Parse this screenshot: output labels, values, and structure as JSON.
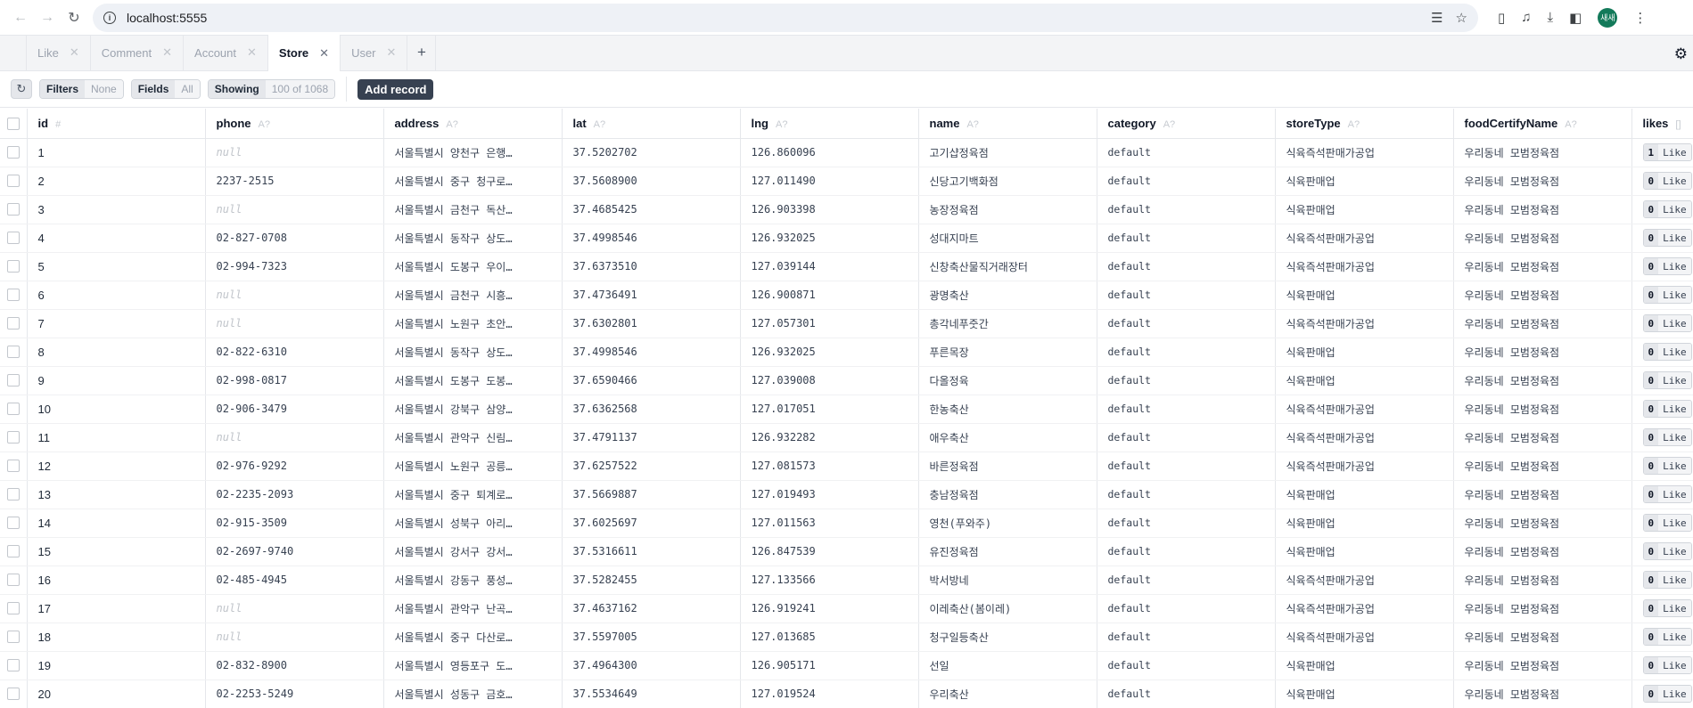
{
  "browser": {
    "url": "localhost:5555",
    "avatar_text": "새새"
  },
  "tabs": [
    {
      "label": "Like",
      "active": false
    },
    {
      "label": "Comment",
      "active": false
    },
    {
      "label": "Account",
      "active": false
    },
    {
      "label": "Store",
      "active": true
    },
    {
      "label": "User",
      "active": false
    }
  ],
  "toolbar": {
    "filters_label": "Filters",
    "filters_value": "None",
    "fields_label": "Fields",
    "fields_value": "All",
    "showing_label": "Showing",
    "showing_value": "100 of 1068",
    "add_record_label": "Add record"
  },
  "columns": [
    {
      "name": "id",
      "type": "#"
    },
    {
      "name": "phone",
      "type": "A?"
    },
    {
      "name": "address",
      "type": "A?"
    },
    {
      "name": "lat",
      "type": "A?"
    },
    {
      "name": "lng",
      "type": "A?"
    },
    {
      "name": "name",
      "type": "A?"
    },
    {
      "name": "category",
      "type": "A?"
    },
    {
      "name": "storeType",
      "type": "A?"
    },
    {
      "name": "foodCertifyName",
      "type": "A?"
    },
    {
      "name": "likes",
      "type": "[]"
    }
  ],
  "like_label": "Like",
  "null_text": "null",
  "rows": [
    {
      "id": "1",
      "phone": null,
      "address": "서울특별시 양천구 은행…",
      "lat": "37.5202702",
      "lng": "126.860096",
      "name": "고기샵정육점",
      "category": "default",
      "storeType": "식육즉석판매가공업",
      "foodCertifyName": "우리동네 모범정육점",
      "likes": "1"
    },
    {
      "id": "2",
      "phone": "2237-2515",
      "address": "서울특별시 중구 청구로…",
      "lat": "37.5608900",
      "lng": "127.011490",
      "name": "신당고기백화점",
      "category": "default",
      "storeType": "식육판매업",
      "foodCertifyName": "우리동네 모범정육점",
      "likes": "0"
    },
    {
      "id": "3",
      "phone": null,
      "address": "서울특별시 금천구 독산…",
      "lat": "37.4685425",
      "lng": "126.903398",
      "name": "농장정육점",
      "category": "default",
      "storeType": "식육판매업",
      "foodCertifyName": "우리동네 모범정육점",
      "likes": "0"
    },
    {
      "id": "4",
      "phone": "02-827-0708",
      "address": "서울특별시 동작구 상도…",
      "lat": "37.4998546",
      "lng": "126.932025",
      "name": "성대지마트",
      "category": "default",
      "storeType": "식육즉석판매가공업",
      "foodCertifyName": "우리동네 모범정육점",
      "likes": "0"
    },
    {
      "id": "5",
      "phone": "02-994-7323",
      "address": "서울특별시 도봉구 우이…",
      "lat": "37.6373510",
      "lng": "127.039144",
      "name": "신창축산물직거래장터",
      "category": "default",
      "storeType": "식육즉석판매가공업",
      "foodCertifyName": "우리동네 모범정육점",
      "likes": "0"
    },
    {
      "id": "6",
      "phone": null,
      "address": "서울특별시 금천구 시흥…",
      "lat": "37.4736491",
      "lng": "126.900871",
      "name": "광명축산",
      "category": "default",
      "storeType": "식육판매업",
      "foodCertifyName": "우리동네 모범정육점",
      "likes": "0"
    },
    {
      "id": "7",
      "phone": null,
      "address": "서울특별시 노원구 초안…",
      "lat": "37.6302801",
      "lng": "127.057301",
      "name": "총각네푸줏간",
      "category": "default",
      "storeType": "식육즉석판매가공업",
      "foodCertifyName": "우리동네 모범정육점",
      "likes": "0"
    },
    {
      "id": "8",
      "phone": "02-822-6310",
      "address": "서울특별시 동작구 상도…",
      "lat": "37.4998546",
      "lng": "126.932025",
      "name": "푸른목장",
      "category": "default",
      "storeType": "식육판매업",
      "foodCertifyName": "우리동네 모범정육점",
      "likes": "0"
    },
    {
      "id": "9",
      "phone": "02-998-0817",
      "address": "서울특별시 도봉구 도봉…",
      "lat": "37.6590466",
      "lng": "127.039008",
      "name": "다올정육",
      "category": "default",
      "storeType": "식육판매업",
      "foodCertifyName": "우리동네 모범정육점",
      "likes": "0"
    },
    {
      "id": "10",
      "phone": "02-906-3479",
      "address": "서울특별시 강북구 삼양…",
      "lat": "37.6362568",
      "lng": "127.017051",
      "name": "한농축산",
      "category": "default",
      "storeType": "식육즉석판매가공업",
      "foodCertifyName": "우리동네 모범정육점",
      "likes": "0"
    },
    {
      "id": "11",
      "phone": null,
      "address": "서울특별시 관악구 신림…",
      "lat": "37.4791137",
      "lng": "126.932282",
      "name": "애우축산",
      "category": "default",
      "storeType": "식육즉석판매가공업",
      "foodCertifyName": "우리동네 모범정육점",
      "likes": "0"
    },
    {
      "id": "12",
      "phone": "02-976-9292",
      "address": "서울특별시 노원구 공릉…",
      "lat": "37.6257522",
      "lng": "127.081573",
      "name": "바른정육점",
      "category": "default",
      "storeType": "식육즉석판매가공업",
      "foodCertifyName": "우리동네 모범정육점",
      "likes": "0"
    },
    {
      "id": "13",
      "phone": "02-2235-2093",
      "address": "서울특별시 중구 퇴계로…",
      "lat": "37.5669887",
      "lng": "127.019493",
      "name": "충남정육점",
      "category": "default",
      "storeType": "식육판매업",
      "foodCertifyName": "우리동네 모범정육점",
      "likes": "0"
    },
    {
      "id": "14",
      "phone": "02-915-3509",
      "address": "서울특별시 성북구 아리…",
      "lat": "37.6025697",
      "lng": "127.011563",
      "name": "영천(푸와주)",
      "category": "default",
      "storeType": "식육판매업",
      "foodCertifyName": "우리동네 모범정육점",
      "likes": "0"
    },
    {
      "id": "15",
      "phone": "02-2697-9740",
      "address": "서울특별시 강서구 강서…",
      "lat": "37.5316611",
      "lng": "126.847539",
      "name": "유진정육점",
      "category": "default",
      "storeType": "식육판매업",
      "foodCertifyName": "우리동네 모범정육점",
      "likes": "0"
    },
    {
      "id": "16",
      "phone": "02-485-4945",
      "address": "서울특별시 강동구 풍성…",
      "lat": "37.5282455",
      "lng": "127.133566",
      "name": "박서방네",
      "category": "default",
      "storeType": "식육즉석판매가공업",
      "foodCertifyName": "우리동네 모범정육점",
      "likes": "0"
    },
    {
      "id": "17",
      "phone": null,
      "address": "서울특별시 관악구 난곡…",
      "lat": "37.4637162",
      "lng": "126.919241",
      "name": "이레축산(봄이레)",
      "category": "default",
      "storeType": "식육즉석판매가공업",
      "foodCertifyName": "우리동네 모범정육점",
      "likes": "0"
    },
    {
      "id": "18",
      "phone": null,
      "address": "서울특별시 중구 다산로…",
      "lat": "37.5597005",
      "lng": "127.013685",
      "name": "청구일등축산",
      "category": "default",
      "storeType": "식육즉석판매가공업",
      "foodCertifyName": "우리동네 모범정육점",
      "likes": "0"
    },
    {
      "id": "19",
      "phone": "02-832-8900",
      "address": "서울특별시 영등포구 도…",
      "lat": "37.4964300",
      "lng": "126.905171",
      "name": "선일",
      "category": "default",
      "storeType": "식육판매업",
      "foodCertifyName": "우리동네 모범정육점",
      "likes": "0"
    },
    {
      "id": "20",
      "phone": "02-2253-5249",
      "address": "서울특별시 성동구 금호…",
      "lat": "37.5534649",
      "lng": "127.019524",
      "name": "우리축산",
      "category": "default",
      "storeType": "식육판매업",
      "foodCertifyName": "우리동네 모범정육점",
      "likes": "0"
    }
  ]
}
